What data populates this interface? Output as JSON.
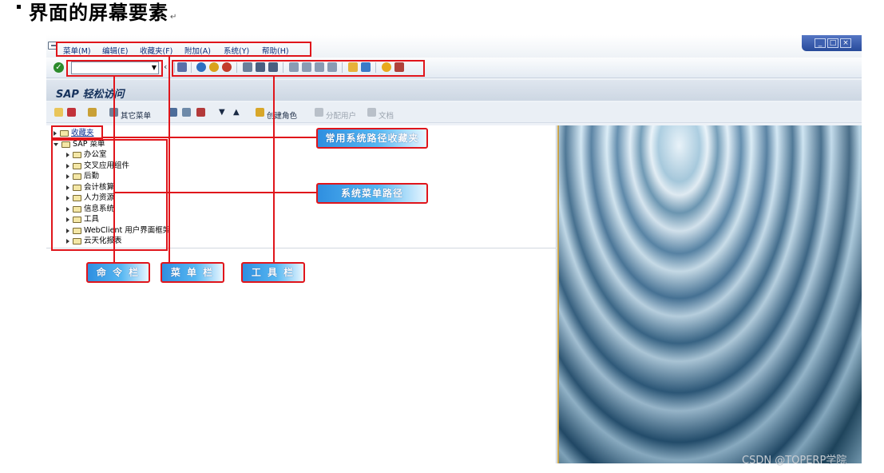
{
  "doc": {
    "title": "界面的屏幕要素",
    "title_mark": "↵"
  },
  "menubar": {
    "items": [
      "菜单(M)",
      "编辑(E)",
      "收藏夹(F)",
      "附加(A)",
      "系统(Y)",
      "帮助(H)"
    ],
    "window_buttons": [
      "_",
      "□",
      "×"
    ]
  },
  "toolbar": {
    "confirm_icon": "check-icon",
    "command_field_value": "",
    "dropdown_glyph": "▼",
    "collapse_glyph": "‹"
  },
  "easy_access": {
    "title": "SAP 轻松访问",
    "app_toolbar": {
      "other_menu": "其它菜单",
      "create_role": "创建角色",
      "assign_user": "分配用户",
      "document": "文档"
    }
  },
  "tree": {
    "favorites": "收藏夹",
    "sap_menu": "SAP 菜单",
    "items": [
      "办公室",
      "交叉应用组件",
      "后勤",
      "会计核算",
      "人力资源",
      "信息系统",
      "工具",
      "WebClient 用户界面框架",
      "云天化报表"
    ]
  },
  "callouts": {
    "favorites_path": "常用系统路径收藏夹",
    "system_menu_path": "系统菜单路径",
    "command_bar": "命 令 栏",
    "menu_bar": "菜 单 栏",
    "toolbar": "工 具 栏"
  },
  "colors": {
    "highlight": "#e0151b",
    "callout_fill": "#2f8fe0",
    "menu_text": "#0b2e7a"
  },
  "watermark": "CSDN @TOPERP学院"
}
